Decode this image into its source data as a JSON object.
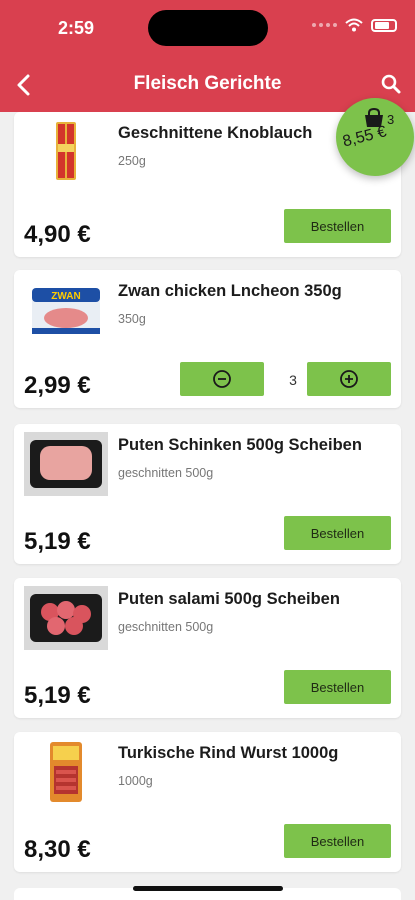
{
  "status_bar": {
    "time": "2:59"
  },
  "nav": {
    "title": "Fleisch Gerichte"
  },
  "cart": {
    "count": "3",
    "total": "8,55 €"
  },
  "products": [
    {
      "name": "Geschnittene  Knoblauch",
      "subtitle": "250g",
      "price": "4,90 €",
      "button": "Bestellen"
    },
    {
      "name": "Zwan chicken Lncheon 350g",
      "subtitle": "350g",
      "price": "2,99 €",
      "quantity": "3",
      "brand": "ZWAN"
    },
    {
      "name": "Puten Schinken 500g Scheiben",
      "subtitle": "geschnitten 500g",
      "price": "5,19 €",
      "button": "Bestellen"
    },
    {
      "name": "Puten salami 500g Scheiben",
      "subtitle": "geschnitten 500g",
      "price": "5,19 €",
      "button": "Bestellen"
    },
    {
      "name": "Turkische  Rind Wurst 1000g",
      "subtitle": "1000g",
      "price": "8,30 €",
      "button": "Bestellen"
    }
  ],
  "colors": {
    "header": "#d9404f",
    "accent": "#7dc24b",
    "background": "#f0f0f0"
  }
}
